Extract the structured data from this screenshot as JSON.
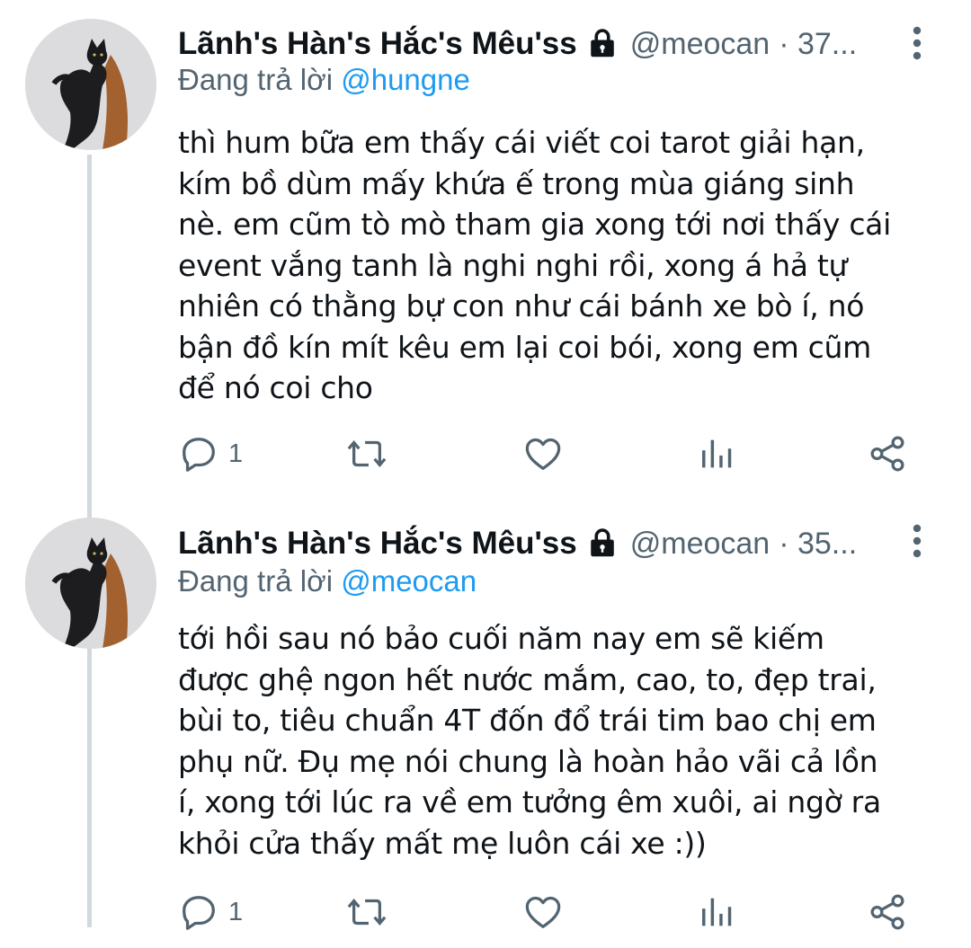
{
  "tweets": [
    {
      "display_name": "Lãnh's Hàn's Hắc's Mêu'ss",
      "handle": "@meocan",
      "time": "· 37...",
      "replying_prefix": "Đang trả lời",
      "replying_to": "@hungne",
      "text": "thì hum bữa em thấy cái viết coi tarot giải hạn,\nkím bồ dùm mấy khứa ế trong mùa giáng sinh\nnè. em cũm tò mò tham gia xong tới nơi thấy cái\nevent vắng tanh là nghi nghi rồi, xong á hả tự\nnhiên có thằng bự con như cái bánh xe bò í, nó\nbận đồ kín mít kêu em lại coi bói, xong em cũm\nđể nó coi cho",
      "reply_count": "1"
    },
    {
      "display_name": "Lãnh's Hàn's Hắc's Mêu'ss",
      "handle": "@meocan",
      "time": "· 35...",
      "replying_prefix": "Đang trả lời",
      "replying_to": "@meocan",
      "text": "tới hồi sau nó bảo cuối năm nay em sẽ kiếm\nđược ghệ ngon hết nước mắm, cao, to, đẹp trai,\nbùi to, tiêu chuẩn 4T đốn đổ trái tim bao chị em\nphụ nữ. Đụ mẹ nói chung là hoàn hảo vãi cả lồn\ní, xong tới lúc ra về em tưởng êm xuôi, ai ngờ ra\nkhỏi cửa thấy mất mẹ luôn cái xe :))",
      "reply_count": "1"
    }
  ],
  "icons": {
    "lock": "lock-icon",
    "more": "more-vertical-icon",
    "reply": "reply-icon",
    "retweet": "retweet-icon",
    "like": "heart-icon",
    "views": "analytics-icon",
    "share": "share-icon"
  },
  "colors": {
    "text": "#0f1419",
    "secondary": "#536471",
    "link": "#1d9bf0",
    "thread_line": "#cfd9de"
  }
}
